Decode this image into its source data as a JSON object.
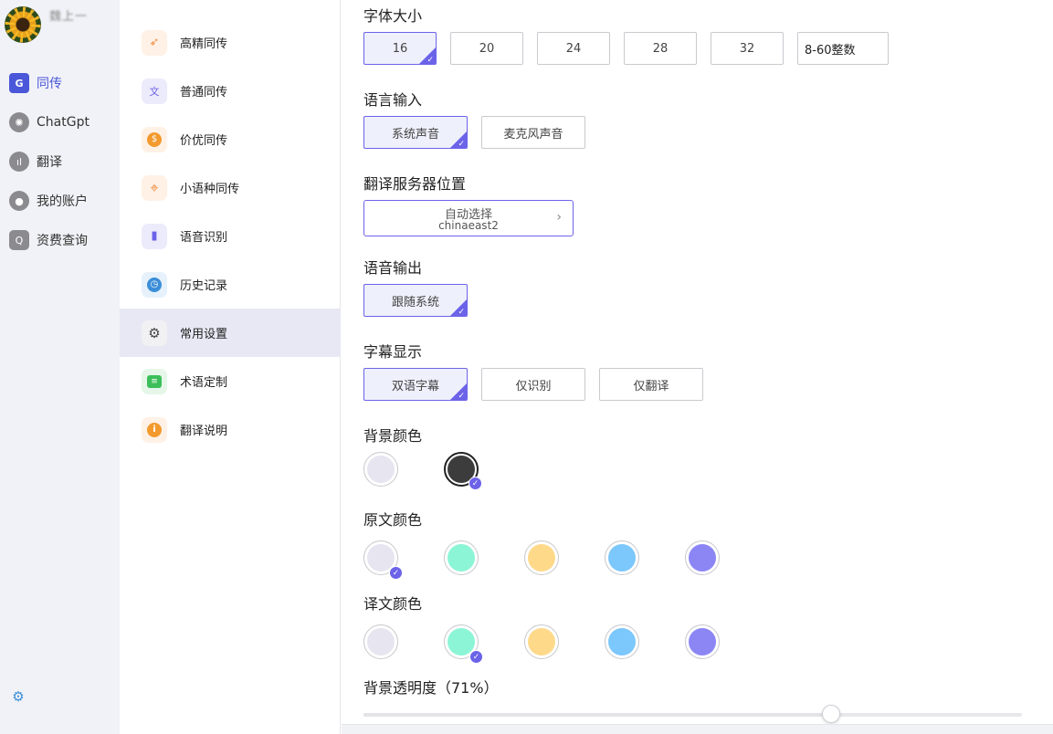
{
  "user": {
    "name": "魏上一"
  },
  "rail": {
    "items": [
      {
        "label": "同传",
        "icon": "translate-icon",
        "active": true,
        "color": "#4a57d8"
      },
      {
        "label": "ChatGpt",
        "icon": "openai-icon",
        "active": false,
        "color": "#777"
      },
      {
        "label": "翻译",
        "icon": "waveform-icon",
        "active": false,
        "color": "#777"
      },
      {
        "label": "我的账户",
        "icon": "user-icon",
        "active": false,
        "color": "#777"
      },
      {
        "label": "资费查询",
        "icon": "search-icon",
        "active": false,
        "color": "#777"
      }
    ]
  },
  "menu": {
    "items": [
      {
        "label": "高精同传",
        "icon": "rocket-icon",
        "glyph": "🚀",
        "bg": "#fff1e6",
        "active": false
      },
      {
        "label": "普通同传",
        "icon": "translate-icon",
        "glyph": "文",
        "bg": "#ecebfb",
        "active": false
      },
      {
        "label": "价优同传",
        "icon": "coin-icon",
        "glyph": "$",
        "bg": "#fff1e6",
        "active": false
      },
      {
        "label": "小语种同传",
        "icon": "target-icon",
        "glyph": "◎",
        "bg": "#fff1e6",
        "active": false
      },
      {
        "label": "语音识别",
        "icon": "mic-icon",
        "glyph": "🎙",
        "bg": "#ecebfb",
        "active": false
      },
      {
        "label": "历史记录",
        "icon": "clock-icon",
        "glyph": "◷",
        "bg": "#e6f1fb",
        "active": false
      },
      {
        "label": "常用设置",
        "icon": "gear-icon",
        "glyph": "⚙",
        "bg": "#f1f1f4",
        "active": true
      },
      {
        "label": "术语定制",
        "icon": "chat-icon",
        "glyph": "≡",
        "bg": "#e6f6e9",
        "active": false
      },
      {
        "label": "翻译说明",
        "icon": "info-icon",
        "glyph": "i",
        "bg": "#fff1e6",
        "active": false
      }
    ]
  },
  "settings": {
    "font_size": {
      "title": "字体大小",
      "options": [
        "16",
        "20",
        "24",
        "28",
        "32"
      ],
      "selected": "16",
      "custom_placeholder": "8-60整数"
    },
    "language_input": {
      "title": "语言输入",
      "options": [
        "系统声音",
        "麦克风声音"
      ],
      "selected": "系统声音"
    },
    "server": {
      "title": "翻译服务器位置",
      "name": "自动选择",
      "id": "chinaeast2"
    },
    "voice_output": {
      "title": "语音输出",
      "options": [
        "跟随系统"
      ],
      "selected": "跟随系统"
    },
    "subtitle": {
      "title": "字幕显示",
      "options": [
        "双语字幕",
        "仅识别",
        "仅翻译"
      ],
      "selected": "双语字幕"
    },
    "background_color": {
      "title": "背景颜色",
      "colors": [
        "#e6e5f0",
        "#3c3c3c"
      ],
      "selected_index": 1
    },
    "source_color": {
      "title": "原文颜色",
      "colors": [
        "#e6e5f0",
        "#8cf5d6",
        "#ffd98a",
        "#7cc7fb",
        "#8c86f5"
      ],
      "selected_index": 0
    },
    "target_color": {
      "title": "译文颜色",
      "colors": [
        "#e6e5f0",
        "#8cf5d6",
        "#ffd98a",
        "#7cc7fb",
        "#8c86f5"
      ],
      "selected_index": 1
    },
    "opacity": {
      "title": "背景透明度（71%）",
      "value_percent": 71
    }
  }
}
